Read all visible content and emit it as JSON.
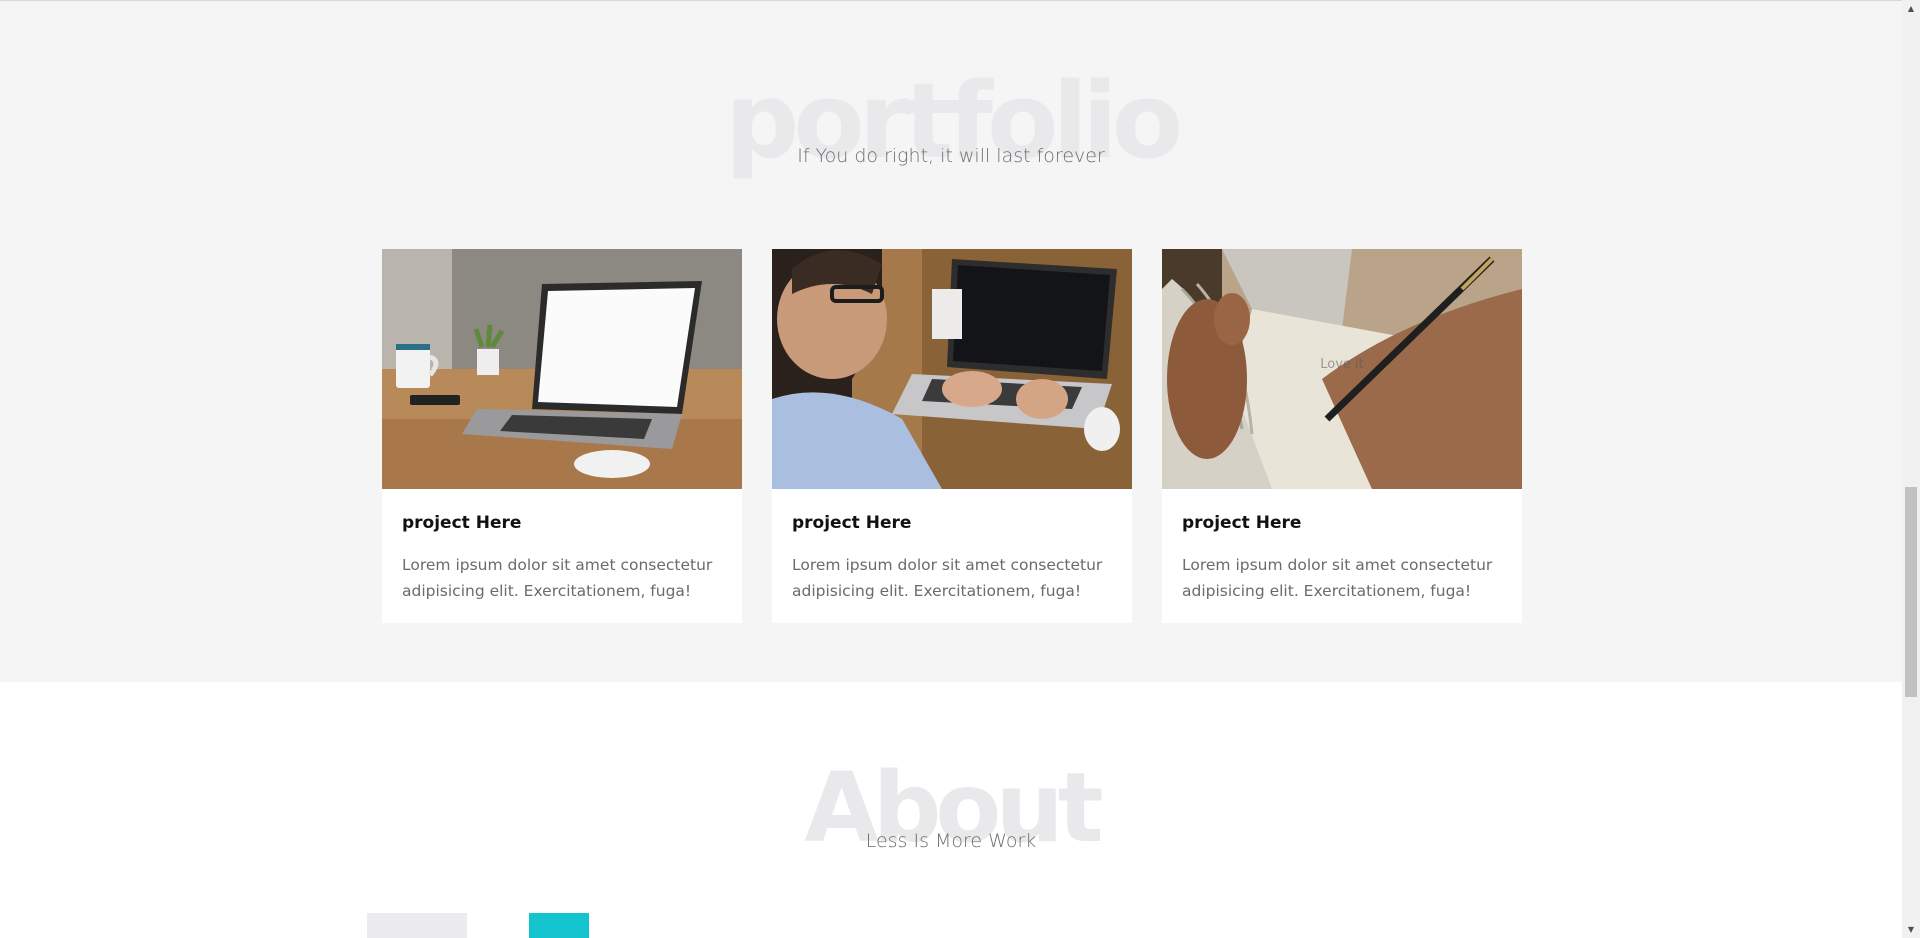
{
  "portfolio": {
    "watermark": "portfolio",
    "subtitle": "If You do right, it will last forever",
    "cards": [
      {
        "title": "project Here",
        "text": "Lorem ipsum dolor sit amet consectetur adipisicing elit. Exercitationem, fuga!",
        "image": "laptop-on-desk-photo"
      },
      {
        "title": "project Here",
        "text": "Lorem ipsum dolor sit amet consectetur adipisicing elit. Exercitationem, fuga!",
        "image": "man-typing-laptop-photo"
      },
      {
        "title": "project Here",
        "text": "Lorem ipsum dolor sit amet consectetur adipisicing elit. Exercitationem, fuga!",
        "image": "hand-writing-notebook-photo",
        "overlay": "Love it"
      }
    ]
  },
  "about": {
    "watermark": "About",
    "subtitle": "Less Is More Work"
  },
  "colors": {
    "section_bg": "#f5f5f5",
    "watermark": "#e9e9ec",
    "accent": "#13c4cf",
    "text_muted": "#6b6b6b"
  },
  "scrollbar": {
    "up_icon": "scroll-up-arrow",
    "down_icon": "scroll-down-arrow"
  }
}
